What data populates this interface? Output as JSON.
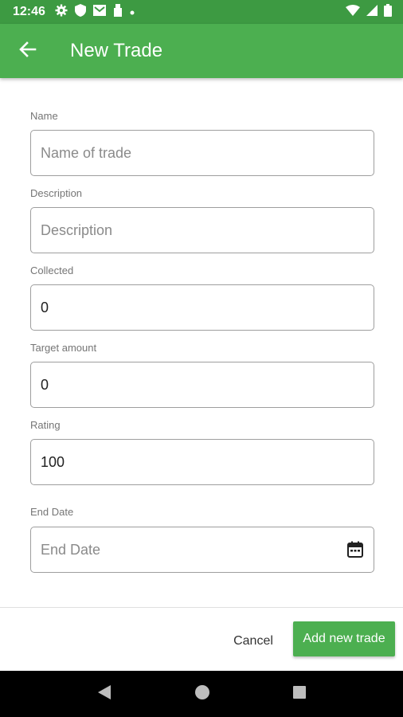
{
  "status_bar": {
    "time": "12:46"
  },
  "app_bar": {
    "title": "New Trade"
  },
  "form": {
    "name": {
      "label": "Name",
      "placeholder": "Name of trade",
      "value": ""
    },
    "description": {
      "label": "Description",
      "placeholder": "Description",
      "value": ""
    },
    "collected": {
      "label": "Collected",
      "value": "0"
    },
    "target_amount": {
      "label": "Target amount",
      "value": "0"
    },
    "rating": {
      "label": "Rating",
      "value": "100"
    },
    "end_date": {
      "label": "End Date",
      "placeholder": "End Date",
      "value": ""
    }
  },
  "actions": {
    "cancel_label": "Cancel",
    "add_label": "Add new trade"
  },
  "colors": {
    "primary": "#4caf50",
    "status_bar": "#3d9a42",
    "border": "#9e9e9e"
  },
  "icons": [
    "settings-icon",
    "shield-icon",
    "mail-icon",
    "usb-icon",
    "dot-icon",
    "wifi-icon",
    "signal-icon",
    "battery-icon",
    "back-arrow-icon",
    "calendar-icon",
    "nav-back-icon",
    "nav-home-icon",
    "nav-recents-icon"
  ]
}
